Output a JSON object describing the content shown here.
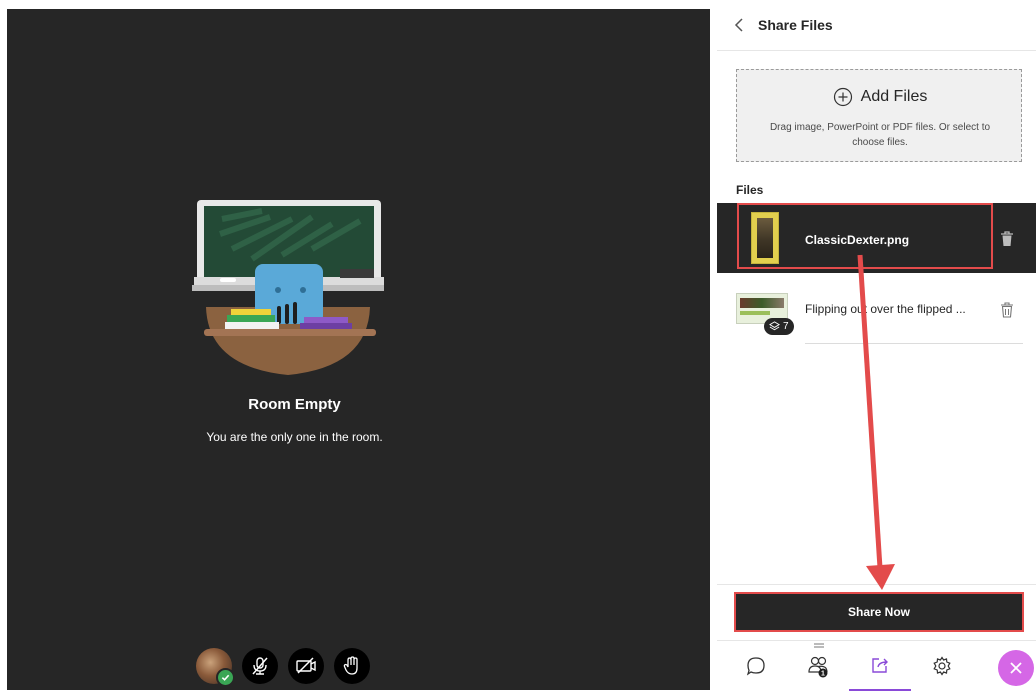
{
  "room": {
    "title": "Room Empty",
    "subtitle": "You are the only one in the room."
  },
  "panel": {
    "title": "Share Files",
    "add_files_label": "Add Files",
    "add_files_hint": "Drag image, PowerPoint or PDF files. Or select to choose files.",
    "files_heading": "Files",
    "files": [
      {
        "name": "ClassicDexter.png"
      },
      {
        "name": "Flipping out over the flipped ...",
        "layers": "7"
      }
    ],
    "share_now_label": "Share Now"
  },
  "tabs": {
    "participants_badge": "1"
  },
  "colors": {
    "stage_bg": "#262626",
    "accent": "#8a4ad8",
    "annotation": "#e34b4b",
    "close": "#d567e6"
  }
}
